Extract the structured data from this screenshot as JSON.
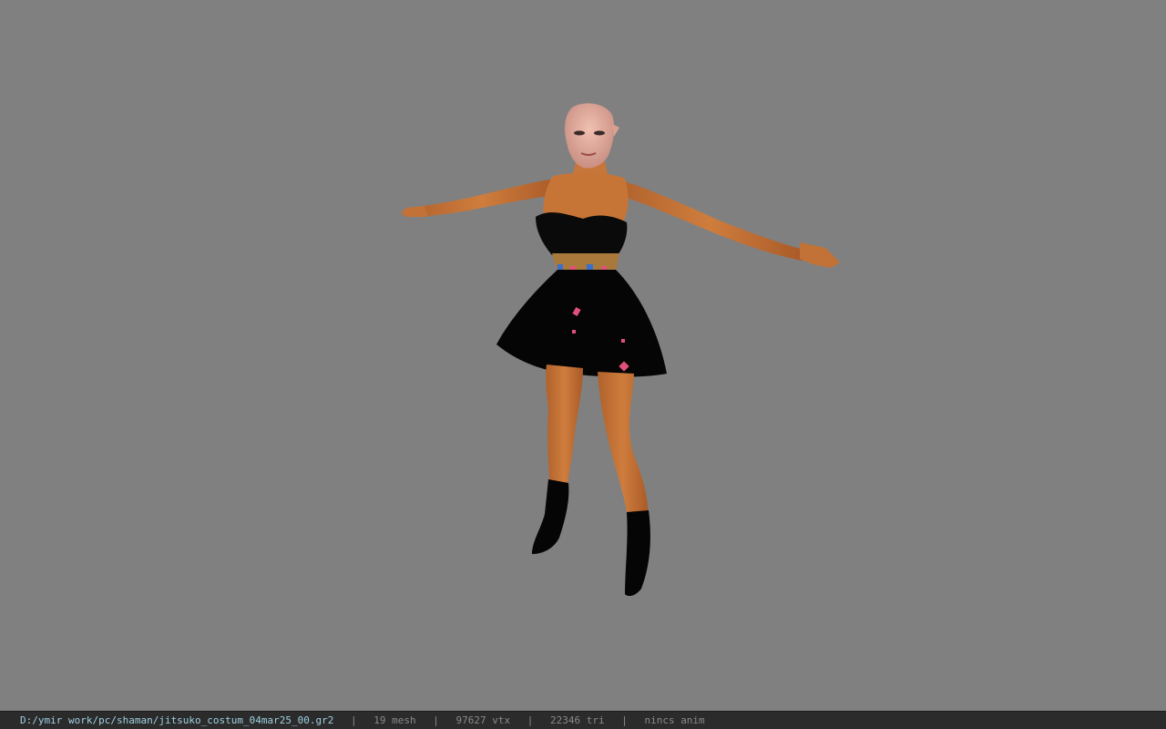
{
  "viewport": {
    "background_color": "#808080",
    "model_description_icon": "character-model"
  },
  "status_bar": {
    "file_path": "D:/ymir work/pc/shaman/jitsuko_costum_04mar25_00.gr2",
    "separator": "|",
    "mesh_count": "19 mesh",
    "vertex_count": "97627 vtx",
    "triangle_count": "22346 tri",
    "anim_status": "nincs anim"
  },
  "colors": {
    "path_text": "#9fd0e0",
    "info_text": "#8a8a8a",
    "status_bg": "#2b2b2b",
    "skin": "#c8773a",
    "dress": "#0a0a0a",
    "accent_pink": "#e0507a"
  }
}
